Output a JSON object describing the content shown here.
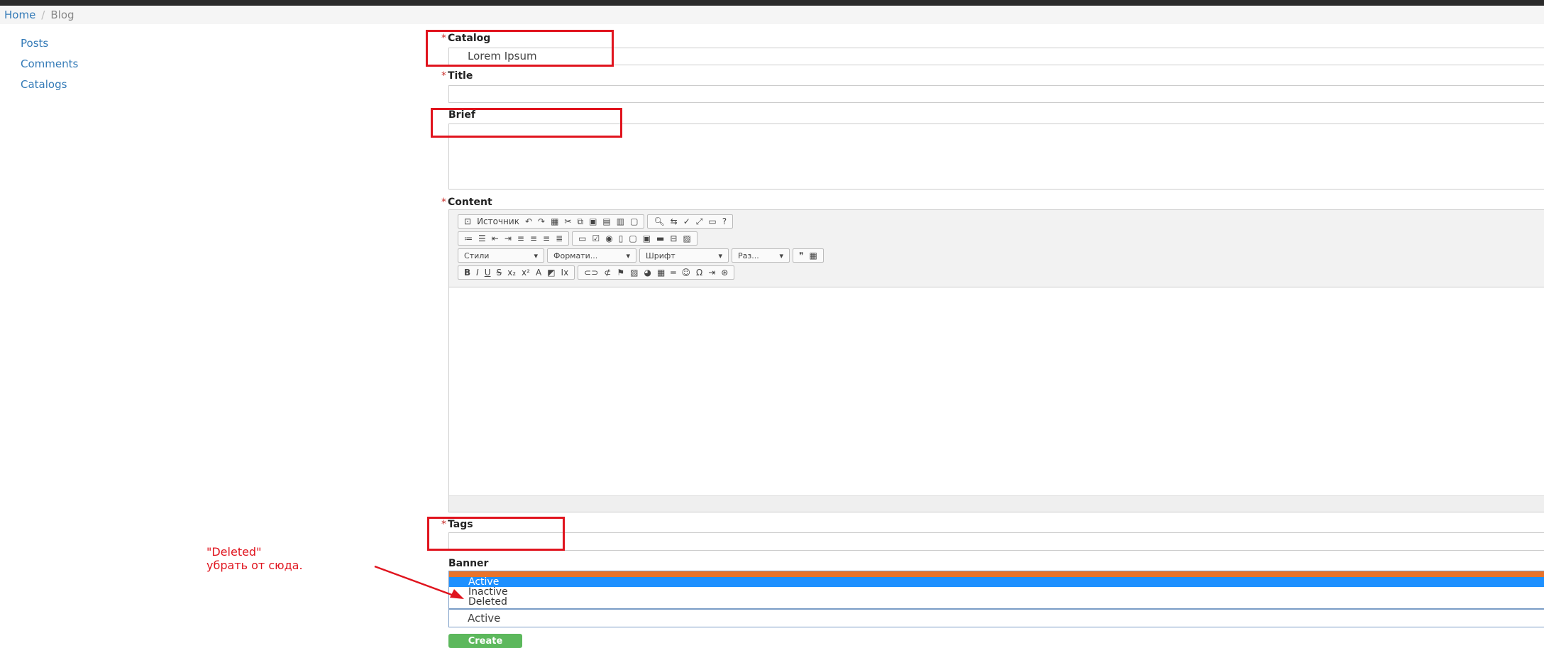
{
  "breadcrumb": {
    "home": "Home",
    "separator": "/",
    "current": "Blog"
  },
  "sidebar": {
    "items": [
      {
        "label": "Posts"
      },
      {
        "label": "Comments"
      },
      {
        "label": "Catalogs"
      }
    ]
  },
  "form": {
    "required_mark": "*",
    "catalog": {
      "label": "Catalog",
      "value": "Lorem Ipsum"
    },
    "title": {
      "label": "Title",
      "value": ""
    },
    "brief": {
      "label": "Brief",
      "value": ""
    },
    "content": {
      "label": "Content",
      "toolbar": {
        "source": "Источник",
        "styles": "Стили",
        "format": "Формати...",
        "font": "Шрифт",
        "size": "Раз..."
      }
    },
    "tags": {
      "label": "Tags",
      "value": ""
    },
    "banner": {
      "label": "Banner",
      "options": [
        "Active",
        "Inactive",
        "Deleted"
      ],
      "value": "Active"
    },
    "submit": "Create"
  },
  "annotation": {
    "line1": "\"Deleted\"",
    "line2": "убрать от сюда."
  },
  "colors": {
    "annotation_red": "#e0141e",
    "link_blue": "#337ab7",
    "create_green": "#5cb85c",
    "select_highlight": "#1e90ff",
    "select_orange": "#e8732b"
  }
}
